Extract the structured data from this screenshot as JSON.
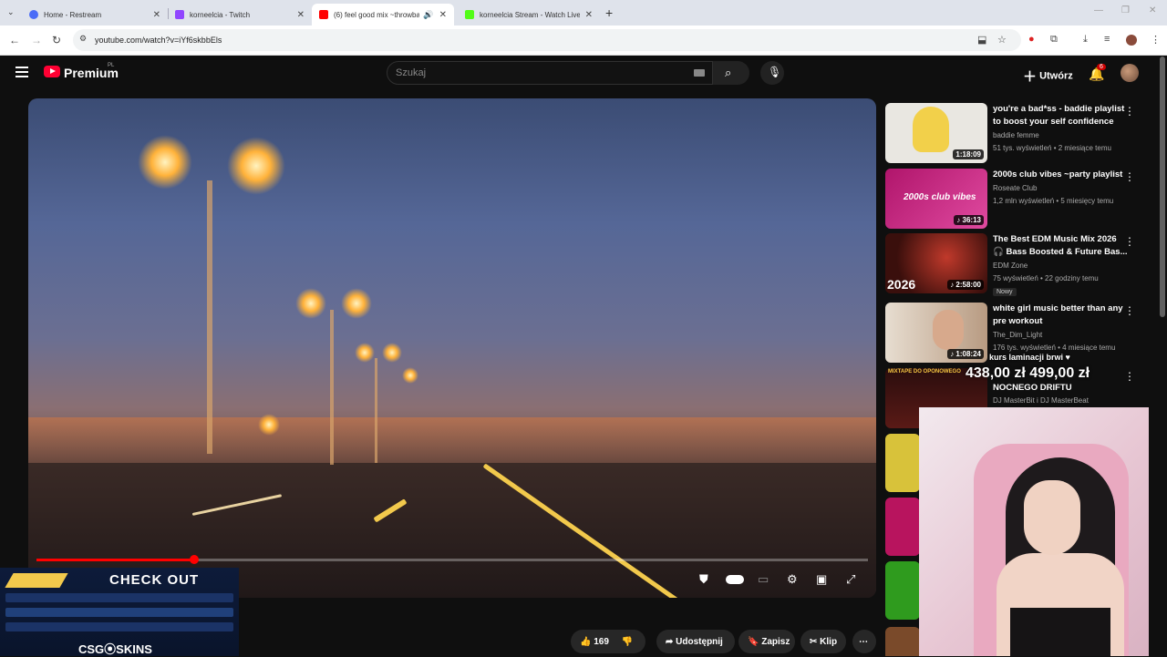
{
  "browser": {
    "tabs": [
      {
        "title": "Home - Restream",
        "color": "#4a6cf7"
      },
      {
        "title": "korneelcia - Twitch",
        "color": "#9146ff"
      },
      {
        "title": "(6) feel good mix ~throwba",
        "color": "#ff0000"
      },
      {
        "title": "korneelcia Stream - Watch Live",
        "color": "#53fc18"
      }
    ],
    "url": "youtube.com/watch?v=iYf6skbbEls"
  },
  "youtube": {
    "brand": "Premium",
    "region": "PL",
    "search_placeholder": "Szukaj",
    "create_label": "Utwórz",
    "notifications": "6"
  },
  "video": {
    "progress_fraction": 0.19
  },
  "actions": {
    "likes": "169",
    "share": "Udostępnij",
    "save": "Zapisz",
    "clip": "Klip"
  },
  "sidebar": [
    {
      "title": "you're a bad*ss - baddie playlist to boost your self confidence",
      "channel": "baddie femme",
      "meta": "51 tys. wyświetleń • 2 miesiące temu",
      "duration": "1:18:09",
      "thumb": "#e9e7e1"
    },
    {
      "title": "2000s club vibes ~party playlist",
      "channel": "Roseate Club",
      "meta": "1,2 mln wyświetleń • 5 miesięcy temu",
      "duration": "36:13",
      "thumb": "#d62c8a",
      "thumb_text": "2000s club vibes"
    },
    {
      "title": "The Best EDM Music Mix 2026 🎧 Bass Boosted & Future Bas...",
      "channel": "EDM Zone",
      "meta": "75 wyświetleń • 22 godziny temu",
      "duration": "2:58:00",
      "badge": "Nowy",
      "thumb": "#5a1f1a",
      "thumb_text": "2026"
    },
    {
      "title": "white girl music better than any pre workout",
      "channel": "The_Dim_Light",
      "meta": "176 tys. wyświetleń • 4 miesiące temu",
      "duration": "1:08:24",
      "thumb": "#c8b8a6"
    },
    {
      "title": "NOCNEGO DRIFTU",
      "channel": "DJ MasterBit i DJ MasterBeat",
      "meta": "",
      "duration": "",
      "thumb": "#3a1010",
      "thumb_text": "MIXTAPE DO OPONOWEGO"
    }
  ],
  "overlays": {
    "stream_text": "kurs laminacji brwi ♥",
    "price": "438,00 zł 499,00 zł",
    "csg_title": "CHECK OUT",
    "csg_brand": "CSG⦿SKINS"
  }
}
